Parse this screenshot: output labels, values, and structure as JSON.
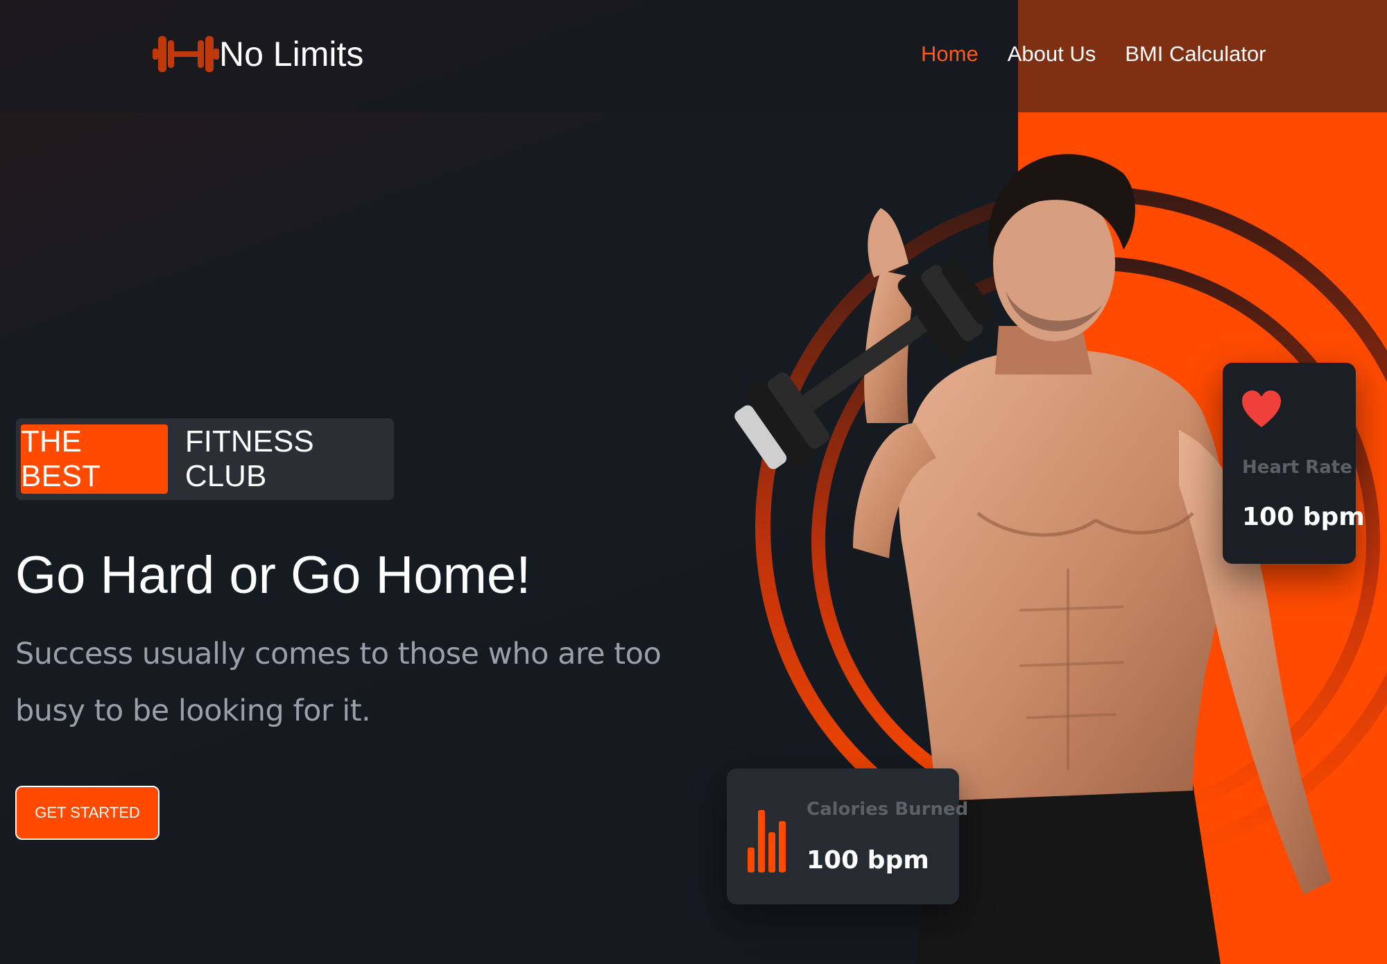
{
  "brand": {
    "name": "No Limits",
    "logo_icon": "dumbbell-icon"
  },
  "nav": {
    "items": [
      {
        "label": "Home",
        "active": true
      },
      {
        "label": "About Us",
        "active": false
      },
      {
        "label": "BMI Calculator",
        "active": false
      }
    ]
  },
  "hero": {
    "badge_highlight": "THE BEST",
    "badge_text": "FITNESS CLUB",
    "headline": "Go Hard or Go Home!",
    "subtext": "Success usually comes to those who are too busy to be looking for it.",
    "cta_label": "GET STARTED"
  },
  "stats": {
    "heart_rate": {
      "icon": "heart-icon",
      "label": "Heart Rate",
      "value": "100 bpm"
    },
    "calories": {
      "icon": "bar-chart-icon",
      "label": "Calories Burned",
      "value": "100 bpm"
    }
  },
  "colors": {
    "accent": "#ff4a00",
    "background": "#161a20",
    "card": "#1b1f25",
    "heart": "#f0403a"
  }
}
